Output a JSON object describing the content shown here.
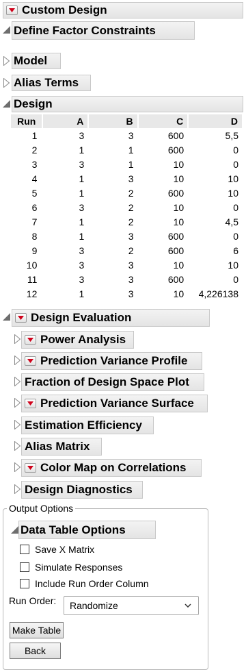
{
  "title": "Custom Design",
  "sections": {
    "define_factor_constraints": "Define Factor Constraints",
    "model": "Model",
    "alias_terms": "Alias Terms",
    "design": "Design"
  },
  "design_table": {
    "headers": [
      "Run",
      "A",
      "B",
      "C",
      "D"
    ],
    "rows": [
      [
        "1",
        "3",
        "3",
        "600",
        "5,5"
      ],
      [
        "2",
        "1",
        "1",
        "600",
        "0"
      ],
      [
        "3",
        "3",
        "1",
        "10",
        "0"
      ],
      [
        "4",
        "1",
        "3",
        "10",
        "10"
      ],
      [
        "5",
        "1",
        "2",
        "600",
        "10"
      ],
      [
        "6",
        "3",
        "2",
        "10",
        "0"
      ],
      [
        "7",
        "1",
        "2",
        "10",
        "4,5"
      ],
      [
        "8",
        "1",
        "3",
        "600",
        "0"
      ],
      [
        "9",
        "3",
        "2",
        "600",
        "6"
      ],
      [
        "10",
        "3",
        "3",
        "10",
        "10"
      ],
      [
        "11",
        "3",
        "3",
        "600",
        "0"
      ],
      [
        "12",
        "1",
        "3",
        "10",
        "4,226138"
      ]
    ]
  },
  "design_evaluation": {
    "title": "Design Evaluation",
    "items": [
      {
        "label": "Power Analysis",
        "menu": true
      },
      {
        "label": "Prediction Variance Profile",
        "menu": true
      },
      {
        "label": "Fraction of Design Space Plot",
        "menu": false
      },
      {
        "label": "Prediction Variance Surface",
        "menu": true
      },
      {
        "label": "Estimation Efficiency",
        "menu": false
      },
      {
        "label": "Alias Matrix",
        "menu": false
      },
      {
        "label": "Color Map on Correlations",
        "menu": true
      },
      {
        "label": "Design Diagnostics",
        "menu": false
      }
    ]
  },
  "output_options": {
    "legend": "Output Options",
    "data_table_options": "Data Table Options",
    "checkboxes": [
      "Save X Matrix",
      "Simulate Responses",
      "Include Run Order Column"
    ],
    "run_order_label": "Run Order:",
    "run_order_value": "Randomize",
    "make_table": "Make Table",
    "back": "Back"
  },
  "colors": {
    "menu_red": "#d0021b",
    "header_gray": "#e8e8e8"
  }
}
